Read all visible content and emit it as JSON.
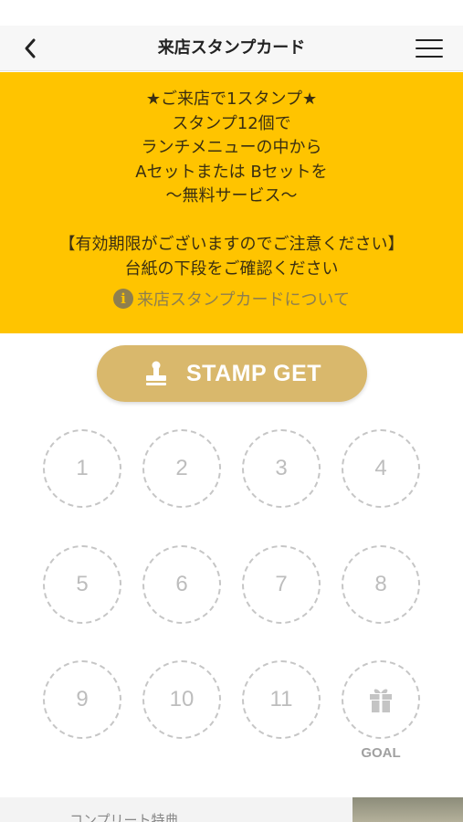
{
  "header": {
    "title": "来店スタンプカード",
    "back_icon": "chevron-left-icon",
    "menu_icon": "hamburger-menu-icon"
  },
  "banner": {
    "background_color": "#ffc400",
    "lines": [
      "★ご来店で1スタンプ★",
      "スタンプ12個で",
      "ランチメニューの中から",
      "Aセットまたは Bセットを",
      "〜無料サービス〜"
    ],
    "notice_lines": [
      "【有効期限がございますのでご注意ください】",
      "台紙の下段をご確認ください"
    ],
    "info_link": {
      "icon": "info-icon",
      "icon_glyph": "i",
      "label": "来店スタンプカードについて"
    }
  },
  "stamp_button": {
    "label": "STAMP GET",
    "icon": "stamp-icon",
    "color": "#d9b86c"
  },
  "stamps": [
    "1",
    "2",
    "3",
    "4",
    "5",
    "6",
    "7",
    "8",
    "9",
    "10",
    "11"
  ],
  "goal": {
    "label": "GOAL",
    "icon": "gift-icon"
  },
  "footer": {
    "text": "コンプリート特典"
  }
}
